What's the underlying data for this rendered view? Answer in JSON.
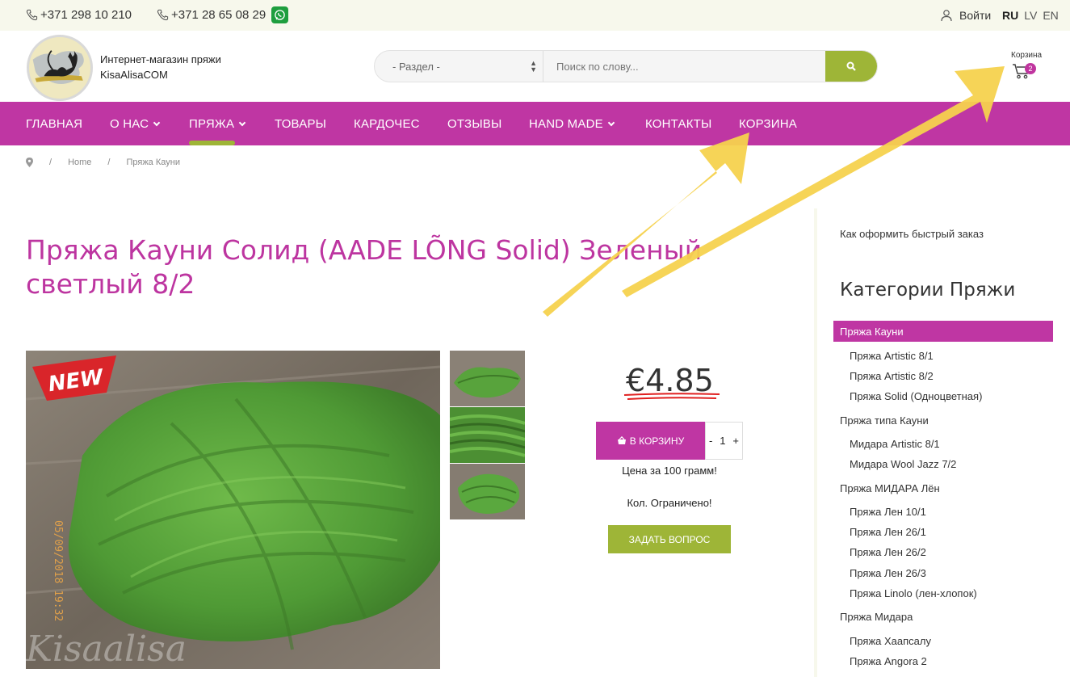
{
  "topbar": {
    "phone1": "+371 298 10 210",
    "phone2": "+371 28 65 08 29",
    "login": "Войти",
    "langs": [
      "RU",
      "LV",
      "EN"
    ]
  },
  "header": {
    "shop_line1": "Интернет-магазин пряжи",
    "shop_line2": "KisaAlisaCOM",
    "section_select": "- Раздел -",
    "search_placeholder": "Поиск по слову...",
    "cart_label": "Корзина",
    "cart_count": "2"
  },
  "nav": {
    "items": [
      "ГЛАВНАЯ",
      "О НАС",
      "ПРЯЖА",
      "ТОВАРЫ",
      "КАРДОЧЕС",
      "ОТЗЫВЫ",
      "HAND MADE",
      "КОНТАКТЫ",
      "КОРЗИНА"
    ]
  },
  "breadcrumb": {
    "home": "Home",
    "current": "Пряжа Кауни"
  },
  "product": {
    "title": "Пряжа Кауни Солид (AADE LÕNG Solid) Зеленый светлый 8/2",
    "new_badge": "NEW",
    "price": "€4.85",
    "add_to_cart": "В КОРЗИНУ",
    "qty_minus": "-",
    "qty_value": "1",
    "qty_plus": "+",
    "price_note": "Цена за 100 грамм!",
    "stock_note": "Кол. Ограничено!",
    "ask_button": "ЗАДАТЬ ВОПРОС",
    "photo_date": "05/09/2018 19:32",
    "watermark": "Kisaalisa"
  },
  "sidebar": {
    "howto": "Как оформить быстрый заказ",
    "categories_title": "Категории Пряжи",
    "active": "Пряжа Кауни",
    "items": [
      {
        "label": "Пряжа Artistic 8/1",
        "level": 2
      },
      {
        "label": "Пряжа Artistic 8/2",
        "level": 2
      },
      {
        "label": "Пряжа Solid (Одноцветная)",
        "level": 2
      },
      {
        "label": "Пряжа типа Кауни",
        "level": 1
      },
      {
        "label": "Мидара Artistic 8/1",
        "level": 2
      },
      {
        "label": "Мидара Wool Jazz 7/2",
        "level": 2
      },
      {
        "label": "Пряжа МИДАРА Лён",
        "level": 1
      },
      {
        "label": "Пряжа Лен 10/1",
        "level": 2
      },
      {
        "label": "Пряжа Лен 26/1",
        "level": 2
      },
      {
        "label": "Пряжа Лен 26/2",
        "level": 2
      },
      {
        "label": "Пряжа Лен 26/3",
        "level": 2
      },
      {
        "label": "Пряжа Linolo (лен-хлопок)",
        "level": 2
      },
      {
        "label": "Пряжа Мидара",
        "level": 1
      },
      {
        "label": "Пряжа Хаапсалу",
        "level": 2
      },
      {
        "label": "Пряжа Angora 2",
        "level": 2
      }
    ]
  },
  "colors": {
    "brand_magenta": "#bf36a3",
    "accent_green": "#9eb537",
    "annotation_arrow": "#f6d24e"
  }
}
